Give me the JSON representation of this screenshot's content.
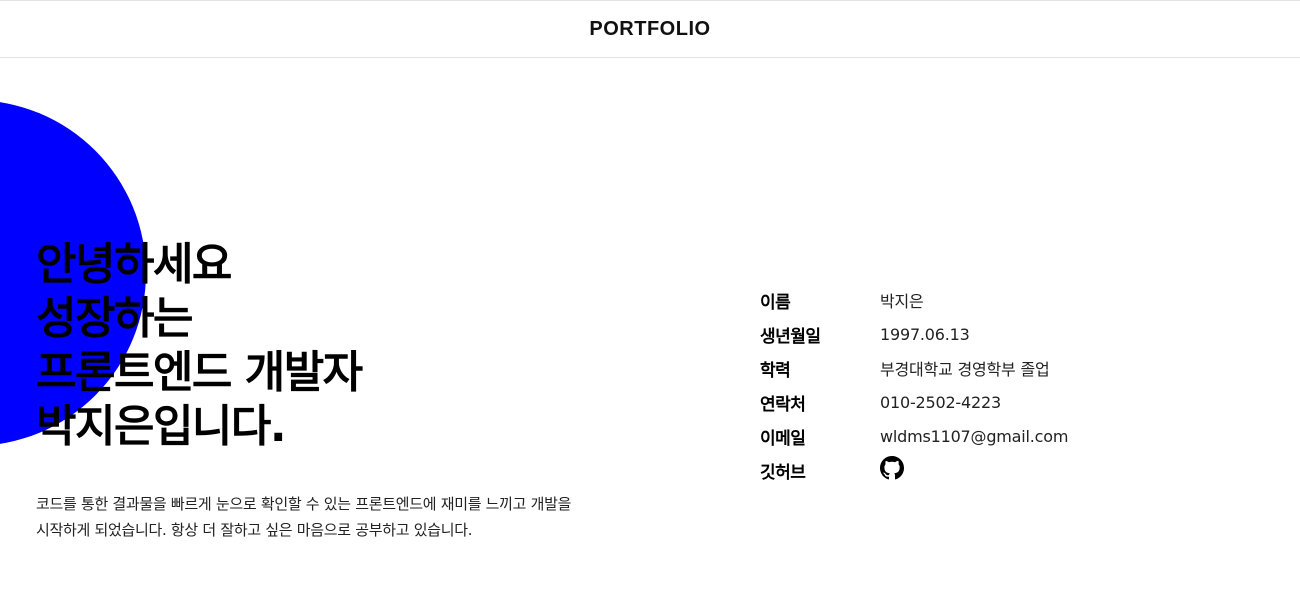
{
  "header": {
    "title": "PORTFOLIO"
  },
  "hero": {
    "greeting_lines": [
      "안녕하세요",
      "성장하는",
      "프론트엔드 개발자",
      "박지은입니다."
    ],
    "intro_lines": [
      "코드를 통한 결과물을 빠르게 눈으로 확인할 수 있는 프론트엔드에 재미를 느끼고 개발을",
      "시작하게 되었습니다. 항상 더 잘하고 싶은 마음으로 공부하고 있습니다."
    ],
    "accent_color": "#0000ff"
  },
  "profile": {
    "rows": [
      {
        "label": "이름",
        "value": "박지은"
      },
      {
        "label": "생년월일",
        "value": "1997.06.13"
      },
      {
        "label": "학력",
        "value": "부경대학교 경영학부 졸업"
      },
      {
        "label": "연락처",
        "value": "010-2502-4223"
      },
      {
        "label": "이메일",
        "value": "wldms1107@gmail.com"
      }
    ],
    "github": {
      "label": "깃허브",
      "icon": "github-icon"
    }
  }
}
